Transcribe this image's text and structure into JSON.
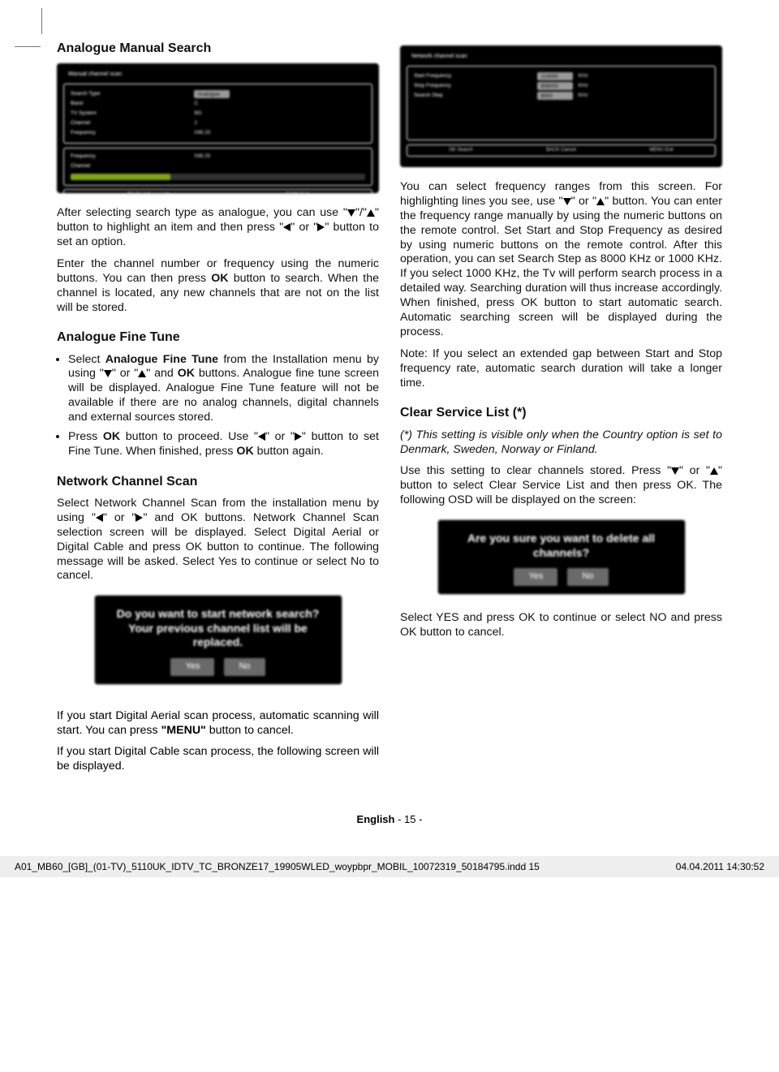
{
  "heading1": "Analogue Manual Search",
  "osd1": {
    "title": "Manual channel scan",
    "rows": [
      {
        "label": "Search Type",
        "value": "Analogue"
      },
      {
        "label": "Band",
        "value": "C"
      },
      {
        "label": "TV System",
        "value": "BG"
      },
      {
        "label": "Channel",
        "value": "2"
      },
      {
        "label": "Frequency",
        "value": "048.25"
      }
    ],
    "strength_rows": [
      {
        "label": "Frequency",
        "value": "048.25"
      },
      {
        "label": "Channel",
        "value": ""
      }
    ],
    "bottom": [
      "OK  Start the search",
      "BACK  Exit"
    ]
  },
  "p1_a": "After selecting search type as analogue, you can use \"",
  "p1_b": "\"/\"",
  "p1_c": "\" button to highlight an item and then press \"",
  "p1_d": "\" or \"",
  "p1_e": "\" button to set an option.",
  "p2_a": "Enter the channel number or frequency using the numeric buttons. You can then press ",
  "p2_b": "OK",
  "p2_c": " button to search. When the channel is located, any new channels that are not on the list will be stored.",
  "heading2": "Analogue Fine Tune",
  "li1_a": "Select ",
  "li1_b": "Analogue Fine Tune",
  "li1_c": " from the Installation menu by using \"",
  "li1_d": "\" or \"",
  "li1_e": "\" and ",
  "li1_f": "OK",
  "li1_g": " buttons. Analogue fine tune screen will be displayed. Analogue Fine Tune feature will not be available if there are no analog channels, digital channels and external sources stored.",
  "li2_a": "Press ",
  "li2_b": "OK",
  "li2_c": " button to proceed. Use \"",
  "li2_d": "\" or \"",
  "li2_e": "\" button to set Fine Tune. When finished, press ",
  "li2_f": "OK",
  "li2_g": " button again.",
  "heading3": "Network Channel Scan",
  "p3_a": "Select Network Channel Scan from the installation menu by using \"",
  "p3_b": "\" or \"",
  "p3_c": "\" and OK buttons. Network Channel Scan selection screen will be displayed. Select Digital Aerial or Digital Cable and press OK button to continue. The following message will be asked. Select Yes to continue or select No to cancel.",
  "popup1": {
    "line1": "Do you want to start network search?",
    "line2": "Your previous channel list will be",
    "line3": "replaced.",
    "yes": "Yes",
    "no": "No"
  },
  "after_p1_a": "If you start Digital Aerial scan process, automatic scanning will start. You can press ",
  "after_p1_b": "\"MENU\"",
  "after_p1_c": " button to cancel.",
  "after_p2": "If you start Digital Cable scan process, the following screen will be displayed.",
  "osd2": {
    "title": "Network channel scan",
    "rows": [
      {
        "label": "Start Frequency",
        "value": "114000",
        "unit": "KHz"
      },
      {
        "label": "Stop Frequency",
        "value": "858000",
        "unit": "KHz"
      },
      {
        "label": "Search Step",
        "value": "8000",
        "unit": "KHz"
      }
    ],
    "bottom": [
      "OK  Search",
      "BACK  Cancel",
      "MENU  Exit"
    ]
  },
  "r_p1_a": "You can select frequency ranges from this screen. For highlighting lines you see, use \"",
  "r_p1_b": "\" or \"",
  "r_p1_c": "\" button. You can enter the frequency range manually by using the numeric buttons on the remote control. Set Start and Stop Frequency as desired by using numeric buttons on the remote control. After this operation, you can set Search Step as 8000 KHz or 1000 KHz. If you select 1000 KHz, the Tv will perform search process in a detailed way. Searching duration will thus increase accordingly. When finished, press OK button to start automatic search. Automatic searching screen will be displayed during the process.",
  "r_p2": "Note: If you select an extended gap between Start and Stop frequency rate, automatic search duration will take a longer time.",
  "heading4": "Clear Service List (*)",
  "r_p3": "(*) This setting is visible only when the Country option is set to Denmark, Sweden, Norway or Finland.",
  "r_p4_a": "Use this setting to clear channels stored. Press \"",
  "r_p4_b": "\" or \"",
  "r_p4_c": "\" button to select Clear Service List and then press OK. The following OSD will be displayed on the screen:",
  "popup2": {
    "line1": "Are you sure you want to delete all",
    "line2": "channels?",
    "yes": "Yes",
    "no": "No"
  },
  "r_p5": "Select YES and press OK to continue or select NO and press OK button to cancel.",
  "footer_lang": "English",
  "footer_page": "  - 15 -",
  "indd_file": "A01_MB60_[GB]_(01-TV)_5110UK_IDTV_TC_BRONZE17_19905WLED_woypbpr_MOBIL_10072319_50184795.indd   15",
  "indd_date": "04.04.2011   14:30:52"
}
